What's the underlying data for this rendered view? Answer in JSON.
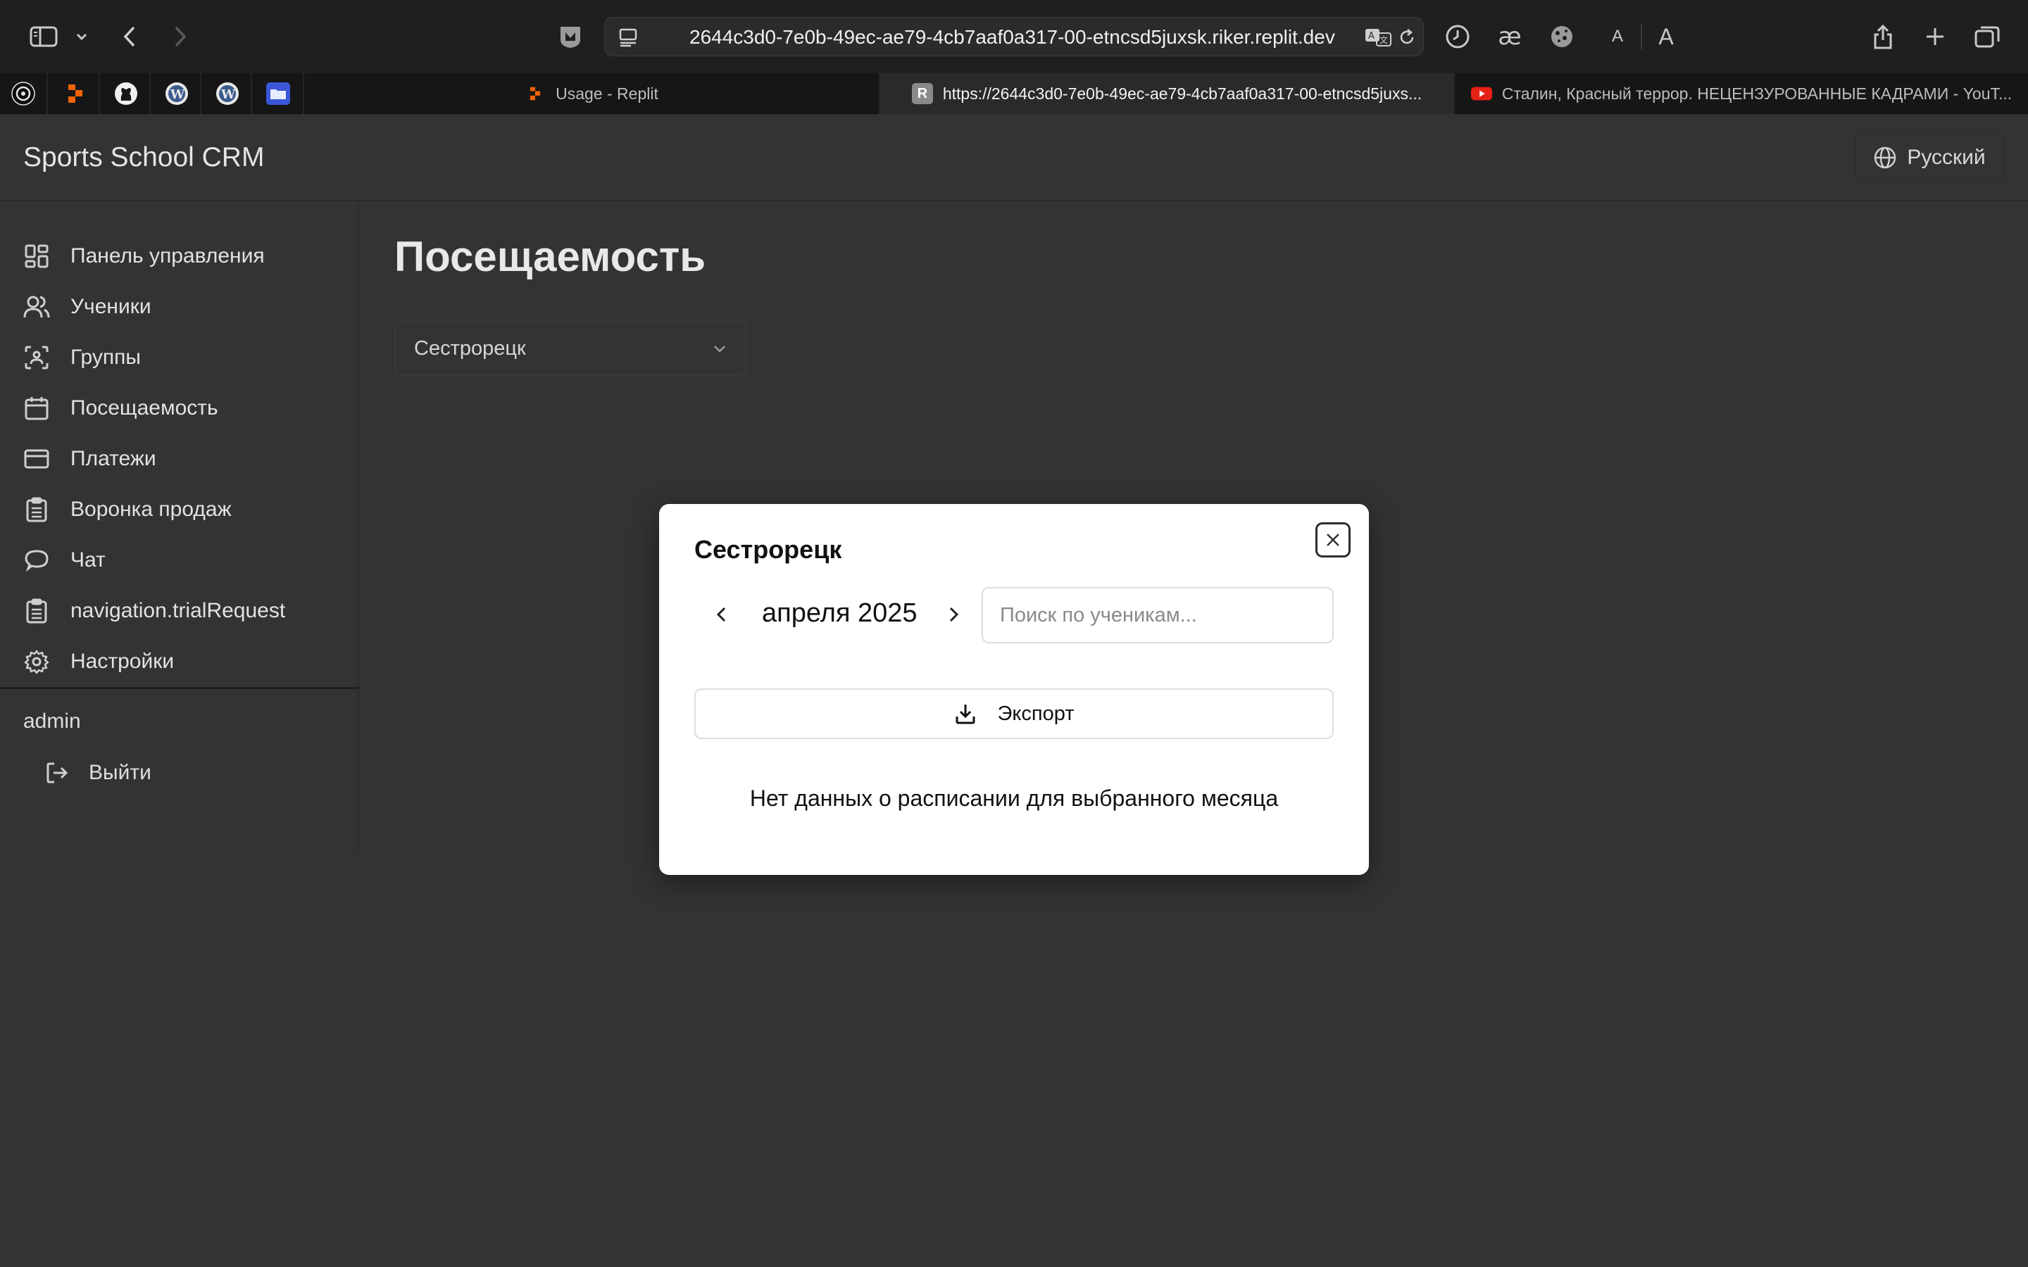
{
  "browser": {
    "url": "2644c3d0-7e0b-49ec-ae79-4cb7aaf0a317-00-etncsd5juxsk.riker.replit.dev",
    "reader_small_a": "A",
    "reader_large_a": "A",
    "tabs": [
      {
        "title": "Usage - Replit",
        "favicon": "replit-icon",
        "active": false
      },
      {
        "title": "https://2644c3d0-7e0b-49ec-ae79-4cb7aaf0a317-00-etncsd5juxs...",
        "favicon": "r-letter-icon",
        "favicon_text": "R",
        "active": true
      },
      {
        "title": "Сталин, Красный террор. НЕЦЕНЗУРОВАННЫЕ КАДРАМИ - YouT...",
        "favicon": "youtube-icon",
        "active": false
      }
    ],
    "pinned_tabs": [
      "chatgpt-icon",
      "replit-icon",
      "github-icon",
      "wordpress-icon",
      "wordpress-icon",
      "folder-icon"
    ]
  },
  "app": {
    "title": "Sports School CRM",
    "language": "Русский"
  },
  "sidebar": {
    "items": [
      {
        "label": "Панель управления",
        "icon": "dashboard-icon"
      },
      {
        "label": "Ученики",
        "icon": "users-icon"
      },
      {
        "label": "Группы",
        "icon": "group-scan-icon"
      },
      {
        "label": "Посещаемость",
        "icon": "calendar-icon"
      },
      {
        "label": "Платежи",
        "icon": "credit-card-icon"
      },
      {
        "label": "Воронка продаж",
        "icon": "clipboard-icon"
      },
      {
        "label": "Чат",
        "icon": "chat-icon"
      },
      {
        "label": "navigation.trialRequest",
        "icon": "clipboard-icon"
      },
      {
        "label": "Настройки",
        "icon": "gear-icon"
      }
    ],
    "user": "admin",
    "logout": "Выйти"
  },
  "main": {
    "title": "Посещаемость",
    "location_select": "Сестрорецк"
  },
  "modal": {
    "title": "Сестрорецк",
    "month": "апреля 2025",
    "search_placeholder": "Поиск по ученикам...",
    "export_label": "Экспорт",
    "empty_message": "Нет данных о расписании для выбранного месяца"
  },
  "colors": {
    "page_bg": "#333333",
    "toolbar_bg": "#1f1f1f",
    "modal_bg": "#ffffff",
    "youtube_red": "#e62117",
    "replit_orange": "#f26207"
  }
}
